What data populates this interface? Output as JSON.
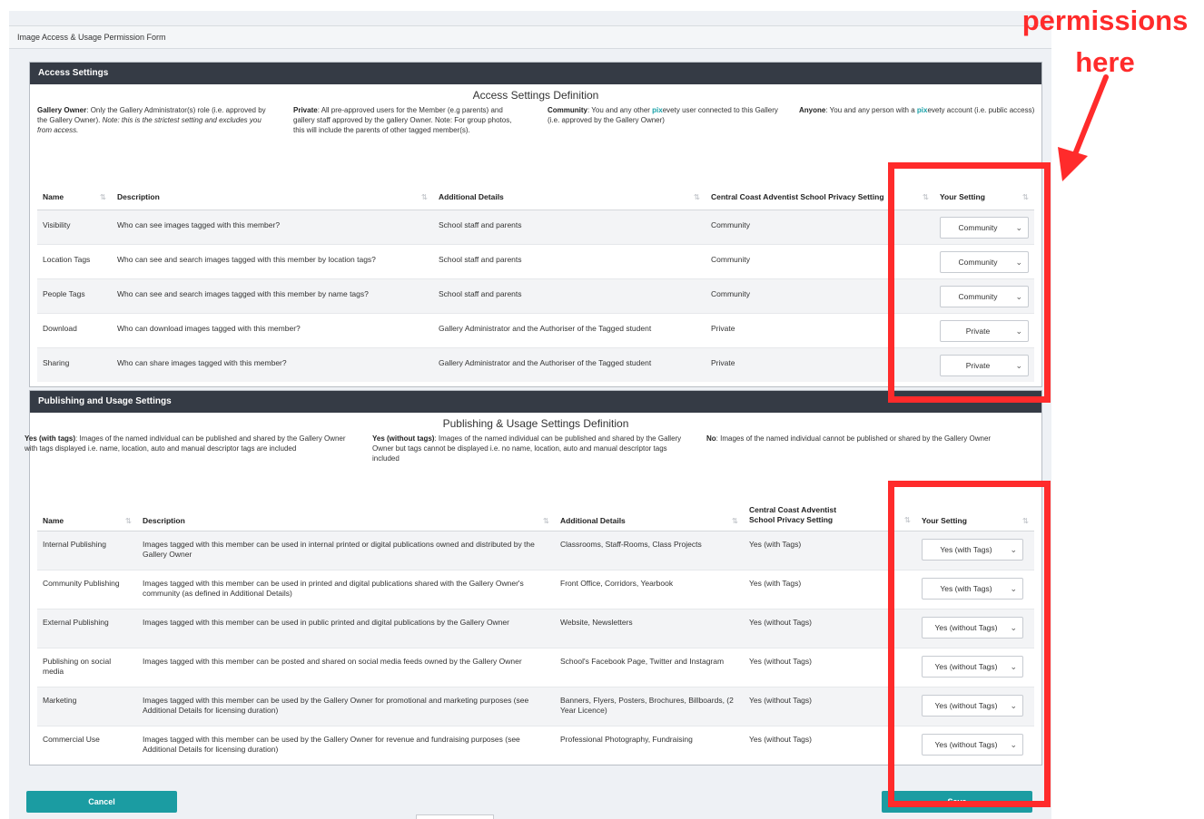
{
  "form_title": "Image Access & Usage Permission Form",
  "access": {
    "header": "Access Settings",
    "definition_title": "Access Settings Definition",
    "defs": {
      "owner_term": "Gallery Owner",
      "owner_text": ": Only the Gallery Administrator(s) role (i.e. approved by the Gallery Owner). ",
      "owner_note": "Note: this is the strictest setting and excludes you from access.",
      "private_term": "Private",
      "private_text": ": All pre-approved users for the Member (e.g parents) and gallery staff approved by the gallery Owner. Note: For group photos, this will include the parents of other tagged member(s).",
      "community_term": "Community",
      "community_text_a": ": You and any other ",
      "community_pix": "pix",
      "community_text_b": "evety user connected to this Gallery (i.e. approved by the Gallery Owner)",
      "anyone_term": "Anyone",
      "anyone_text_a": ": You and any person with a ",
      "anyone_pix": "pix",
      "anyone_text_b": "evety account (i.e. public access)"
    },
    "columns": {
      "name": "Name",
      "description": "Description",
      "details": "Additional Details",
      "school": "Central Coast Adventist School Privacy Setting",
      "setting": "Your Setting"
    },
    "rows": [
      {
        "name": "Visibility",
        "description": "Who can see images tagged with this member?",
        "details": "School staff and parents",
        "school": "Community",
        "setting": "Community"
      },
      {
        "name": "Location Tags",
        "description": "Who can see and search images tagged with this member by location tags?",
        "details": "School staff and parents",
        "school": "Community",
        "setting": "Community"
      },
      {
        "name": "People Tags",
        "description": "Who can see and search images tagged with this member by name tags?",
        "details": "School staff and parents",
        "school": "Community",
        "setting": "Community"
      },
      {
        "name": "Download",
        "description": "Who can download images tagged with this member?",
        "details": "Gallery Administrator and the Authoriser of the Tagged student",
        "school": "Private",
        "setting": "Private"
      },
      {
        "name": "Sharing",
        "description": "Who can share images tagged with this member?",
        "details": "Gallery Administrator and the Authoriser of the Tagged student",
        "school": "Private",
        "setting": "Private"
      }
    ]
  },
  "publishing": {
    "header": "Publishing and Usage Settings",
    "definition_title": "Publishing & Usage Settings Definition",
    "defs": {
      "yes_tags_term": "Yes (with tags)",
      "yes_tags_text": ": Images of the named individual can be published and shared by the Gallery Owner with tags displayed i.e. name, location, auto and manual descriptor tags are included",
      "yes_notags_term": "Yes (without tags)",
      "yes_notags_text": ": Images of the named individual can be published and shared by the Gallery Owner but tags cannot be displayed i.e. no name, location, auto and manual descriptor tags included",
      "no_term": "No",
      "no_text": ": Images of the named individual cannot be published or shared by the Gallery Owner"
    },
    "columns": {
      "name": "Name",
      "description": "Description",
      "details": "Additional Details",
      "school_a": "Central Coast Adventist",
      "school_b": "School Privacy Setting",
      "setting": "Your Setting"
    },
    "rows": [
      {
        "name": "Internal Publishing",
        "description": "Images tagged with this member can be used in internal printed or digital publications owned and distributed by the Gallery Owner",
        "details": "Classrooms, Staff-Rooms, Class Projects",
        "school": "Yes (with Tags)",
        "setting": "Yes (with Tags)"
      },
      {
        "name": "Community Publishing",
        "description": "Images tagged with this member can be used in printed and digital publications shared with the Gallery Owner's community (as defined in Additional Details)",
        "details": "Front Office, Corridors, Yearbook",
        "school": "Yes (with Tags)",
        "setting": "Yes (with Tags)"
      },
      {
        "name": "External Publishing",
        "description": "Images tagged with this member can be used in public printed and digital publications by the Gallery Owner",
        "details": "Website, Newsletters",
        "school": "Yes (without Tags)",
        "setting": "Yes (without Tags)"
      },
      {
        "name": "Publishing on social media",
        "description": "Images tagged with this member can be posted and shared on social media feeds owned by the Gallery Owner",
        "details": "School's Facebook Page, Twitter and Instagram",
        "school": "Yes (without Tags)",
        "setting": "Yes (without Tags)"
      },
      {
        "name": "Marketing",
        "description": "Images tagged with this member can be used by the Gallery Owner for promotional and marketing purposes (see Additional Details for licensing duration)",
        "details": "Banners, Flyers, Posters, Brochures, Billboards, (2 Year Licence)",
        "school": "Yes (without Tags)",
        "setting": "Yes (without Tags)"
      },
      {
        "name": "Commercial Use",
        "description": "Images tagged with this member can be used by the Gallery Owner for revenue and fundraising purposes (see Additional Details for licensing duration)",
        "details": "Professional Photography, Fundraising",
        "school": "Yes (without Tags)",
        "setting": "Yes (without Tags)"
      }
    ]
  },
  "buttons": {
    "cancel": "Cancel",
    "save": "Save"
  },
  "annotation": {
    "line1": "permissions",
    "line2": "here"
  },
  "icons": {
    "sort": "sort-icon",
    "chevron": "chevron-down-icon",
    "arrow": "arrow-icon"
  },
  "colors": {
    "accent": "#1b9ca2",
    "header": "#353b45",
    "highlight": "#ff2b2b",
    "pix": "#18a1a8"
  }
}
